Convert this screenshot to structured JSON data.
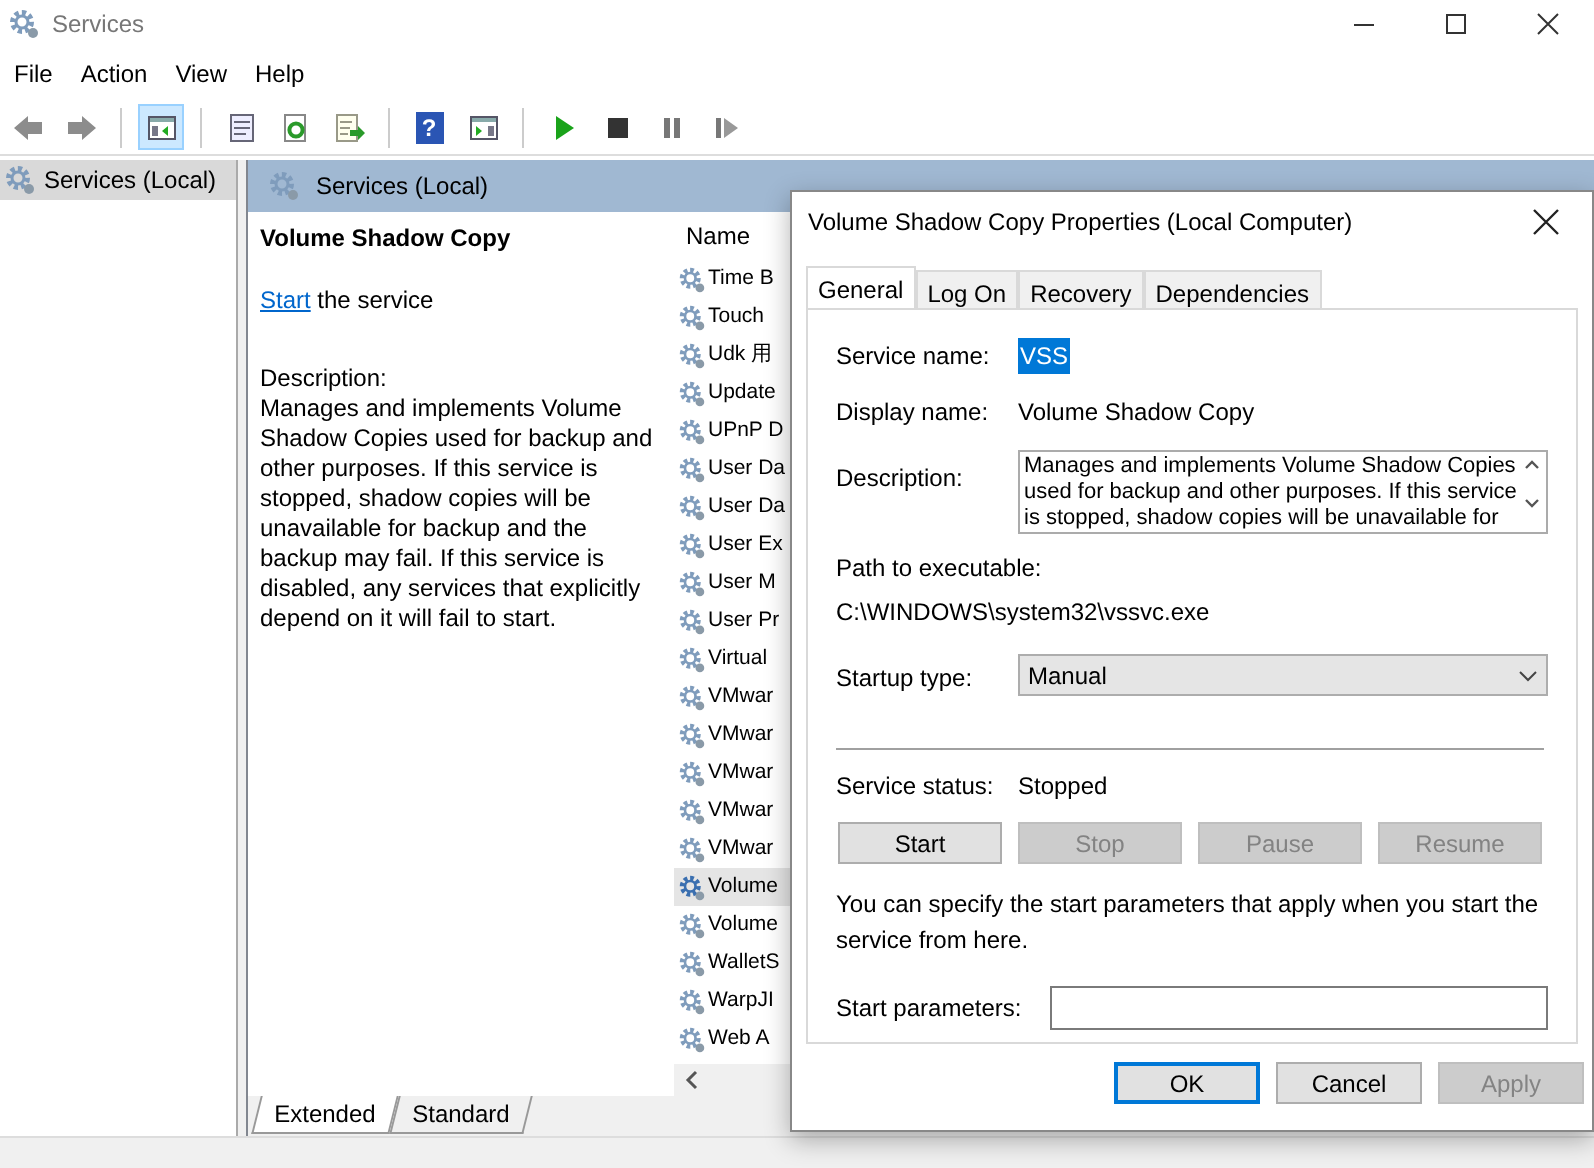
{
  "window": {
    "title": "Services"
  },
  "menu": [
    "File",
    "Action",
    "View",
    "Help"
  ],
  "toolbar": [
    {
      "kind": "back",
      "pressed": false
    },
    {
      "kind": "forward",
      "pressed": false
    },
    {
      "kind": "sep"
    },
    {
      "kind": "console-tree",
      "pressed": true
    },
    {
      "kind": "sep"
    },
    {
      "kind": "properties",
      "pressed": false
    },
    {
      "kind": "refresh",
      "pressed": false
    },
    {
      "kind": "export",
      "pressed": false
    },
    {
      "kind": "sep"
    },
    {
      "kind": "help",
      "glyph": "?",
      "pressed": false
    },
    {
      "kind": "action-pane",
      "pressed": false
    },
    {
      "kind": "sep"
    },
    {
      "kind": "play",
      "pressed": false
    },
    {
      "kind": "stop",
      "pressed": false
    },
    {
      "kind": "pause",
      "pressed": false
    },
    {
      "kind": "resume",
      "pressed": false
    }
  ],
  "tree": [
    {
      "label": "Services (Local)",
      "selected": true
    }
  ],
  "pane_header": "Services (Local)",
  "details": {
    "title": "Volume Shadow Copy",
    "action_link": "Start",
    "action_text": "the service",
    "description_label": "Description:",
    "description": "Manages and implements Volume Shadow Copies used for backup and other purposes. If this service is stopped, shadow copies will be unavailable for backup and the backup may fail. If this service is disabled, any services that explicitly depend on it will fail to start."
  },
  "list": {
    "columns": [
      "Name"
    ],
    "rows": [
      {
        "name": "Time B",
        "selected": false
      },
      {
        "name": "Touch",
        "selected": false
      },
      {
        "name": "Udk 用",
        "selected": false
      },
      {
        "name": "Update",
        "selected": false
      },
      {
        "name": "UPnP D",
        "selected": false
      },
      {
        "name": "User Da",
        "selected": false
      },
      {
        "name": "User Da",
        "selected": false
      },
      {
        "name": "User Ex",
        "selected": false
      },
      {
        "name": "User M",
        "selected": false
      },
      {
        "name": "User Pr",
        "selected": false
      },
      {
        "name": "Virtual",
        "selected": false
      },
      {
        "name": "VMwar",
        "selected": false
      },
      {
        "name": "VMwar",
        "selected": false
      },
      {
        "name": "VMwar",
        "selected": false
      },
      {
        "name": "VMwar",
        "selected": false
      },
      {
        "name": "VMwar",
        "selected": false
      },
      {
        "name": "Volume",
        "selected": true
      },
      {
        "name": "Volume",
        "selected": false
      },
      {
        "name": "WalletS",
        "selected": false
      },
      {
        "name": "WarpJI",
        "selected": false
      },
      {
        "name": "Web A",
        "selected": false
      }
    ]
  },
  "view_tabs": [
    {
      "label": "Extended",
      "selected": true
    },
    {
      "label": "Standard",
      "selected": false
    }
  ],
  "dialog": {
    "title": "Volume Shadow Copy Properties (Local Computer)",
    "tabs": [
      {
        "label": "General",
        "selected": true
      },
      {
        "label": "Log On",
        "selected": false
      },
      {
        "label": "Recovery",
        "selected": false
      },
      {
        "label": "Dependencies",
        "selected": false
      }
    ],
    "service_name": {
      "label": "Service name:",
      "value": "VSS",
      "highlighted": true
    },
    "display_name": {
      "label": "Display name:",
      "value": "Volume Shadow Copy"
    },
    "description": {
      "label": "Description:",
      "value": "Manages and implements Volume Shadow Copies used for backup and other purposes. If this service is stopped, shadow copies will be unavailable for"
    },
    "path": {
      "label": "Path to executable:",
      "value": "C:\\WINDOWS\\system32\\vssvc.exe"
    },
    "startup_type": {
      "label": "Startup type:",
      "value": "Manual"
    },
    "status": {
      "label": "Service status:",
      "value": "Stopped"
    },
    "service_buttons": [
      {
        "label": "Start",
        "disabled": false
      },
      {
        "label": "Stop",
        "disabled": true
      },
      {
        "label": "Pause",
        "disabled": true
      },
      {
        "label": "Resume",
        "disabled": true
      }
    ],
    "hint": "You can specify the start parameters that apply when you start the service from here.",
    "start_parameters": {
      "label": "Start parameters:"
    },
    "footer_buttons": [
      {
        "label": "OK",
        "default": true,
        "disabled": false
      },
      {
        "label": "Cancel",
        "default": false,
        "disabled": false
      },
      {
        "label": "Apply",
        "default": false,
        "disabled": true
      }
    ]
  }
}
